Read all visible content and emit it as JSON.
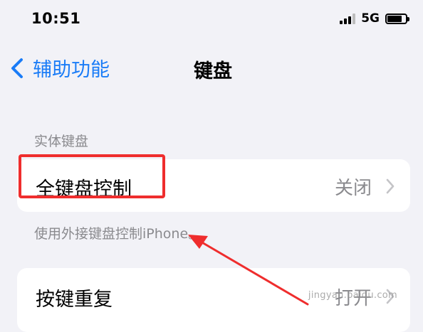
{
  "status_bar": {
    "time": "10:51",
    "network": "5G",
    "icons": [
      "signal-icon",
      "battery-icon"
    ]
  },
  "nav": {
    "back_label": "辅助功能",
    "title": "键盘",
    "back_icon": "chevron-left-icon"
  },
  "physical_keyboard": {
    "header": "实体键盘",
    "full_keyboard_control": {
      "label": "全键盘控制",
      "value": "关闭"
    },
    "footer": "使用外接键盘控制iPhone。"
  },
  "key_repeat": {
    "label": "按键重复",
    "value": "打开"
  },
  "watermark": {
    "text": "jingyan.baidu.com"
  },
  "colors": {
    "background": "#f2f2f7",
    "accent": "#1a7cf7",
    "annotation": "#ef2d2d",
    "secondary_text": "#8a8a8e"
  }
}
